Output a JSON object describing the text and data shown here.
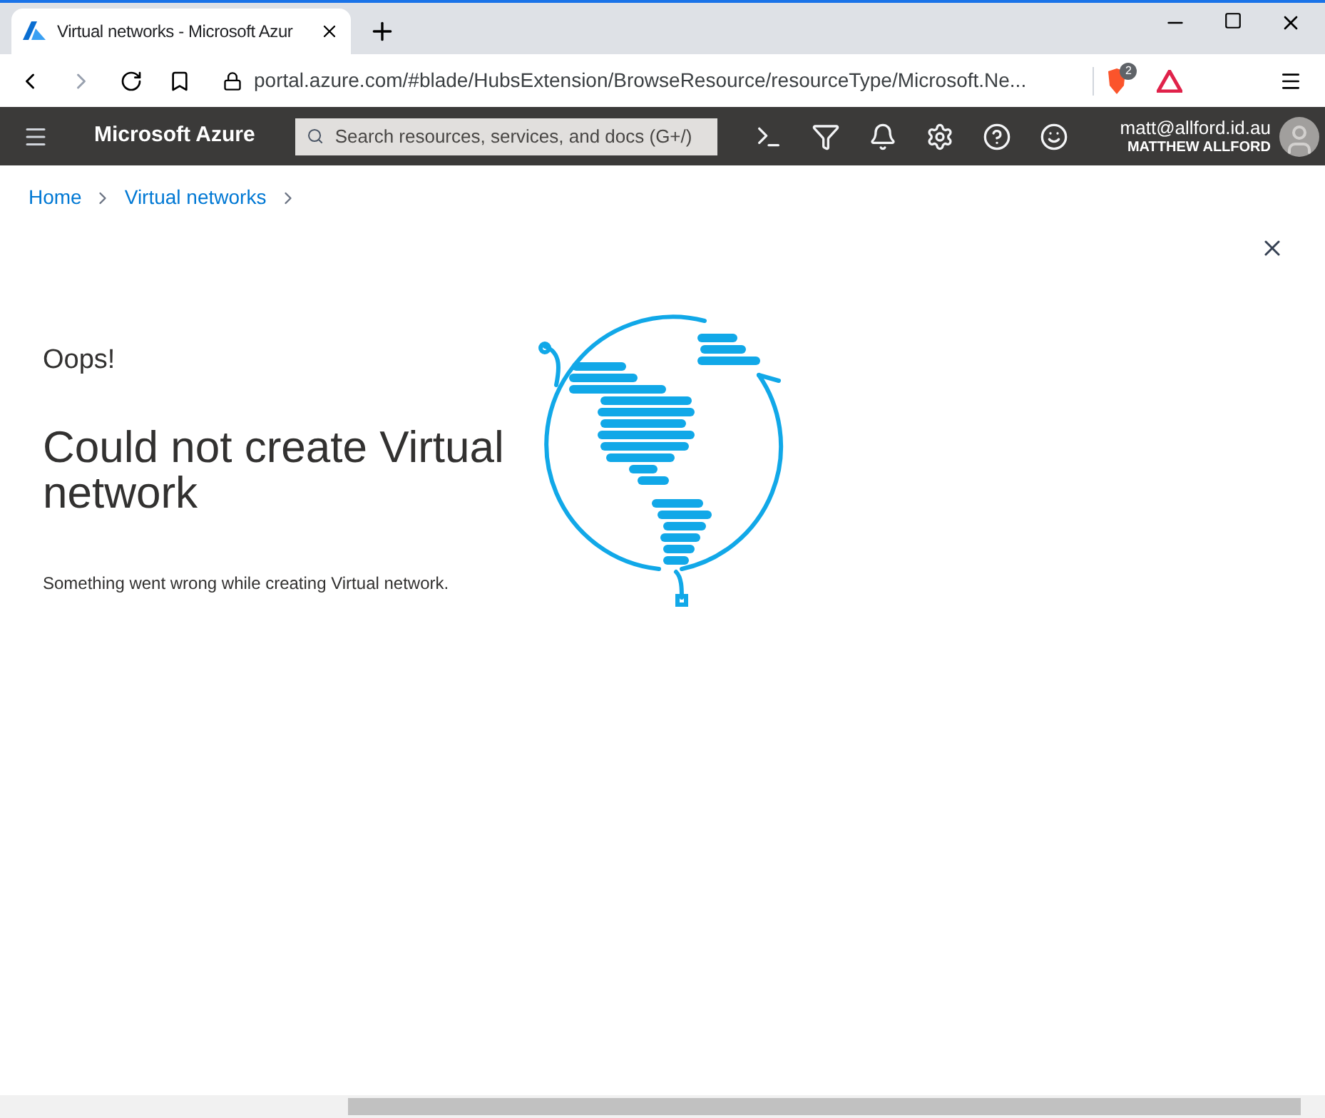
{
  "browser": {
    "tab_title": "Virtual networks - Microsoft Azur",
    "url": "portal.azure.com/#blade/HubsExtension/BrowseResource/resourceType/Microsoft.Ne...",
    "shield_badge": "2"
  },
  "header": {
    "app_name": "Microsoft Azure",
    "search": {
      "placeholder": "Search resources, services, and docs (G+/)"
    },
    "user_email": "matt@allford.id.au",
    "user_name": "MATTHEW ALLFORD"
  },
  "breadcrumb": [
    "Home",
    "Virtual networks"
  ],
  "error": {
    "eyebrow": "Oops!",
    "title": "Could not create Virtual network",
    "message": "Something went wrong while creating Virtual network."
  }
}
